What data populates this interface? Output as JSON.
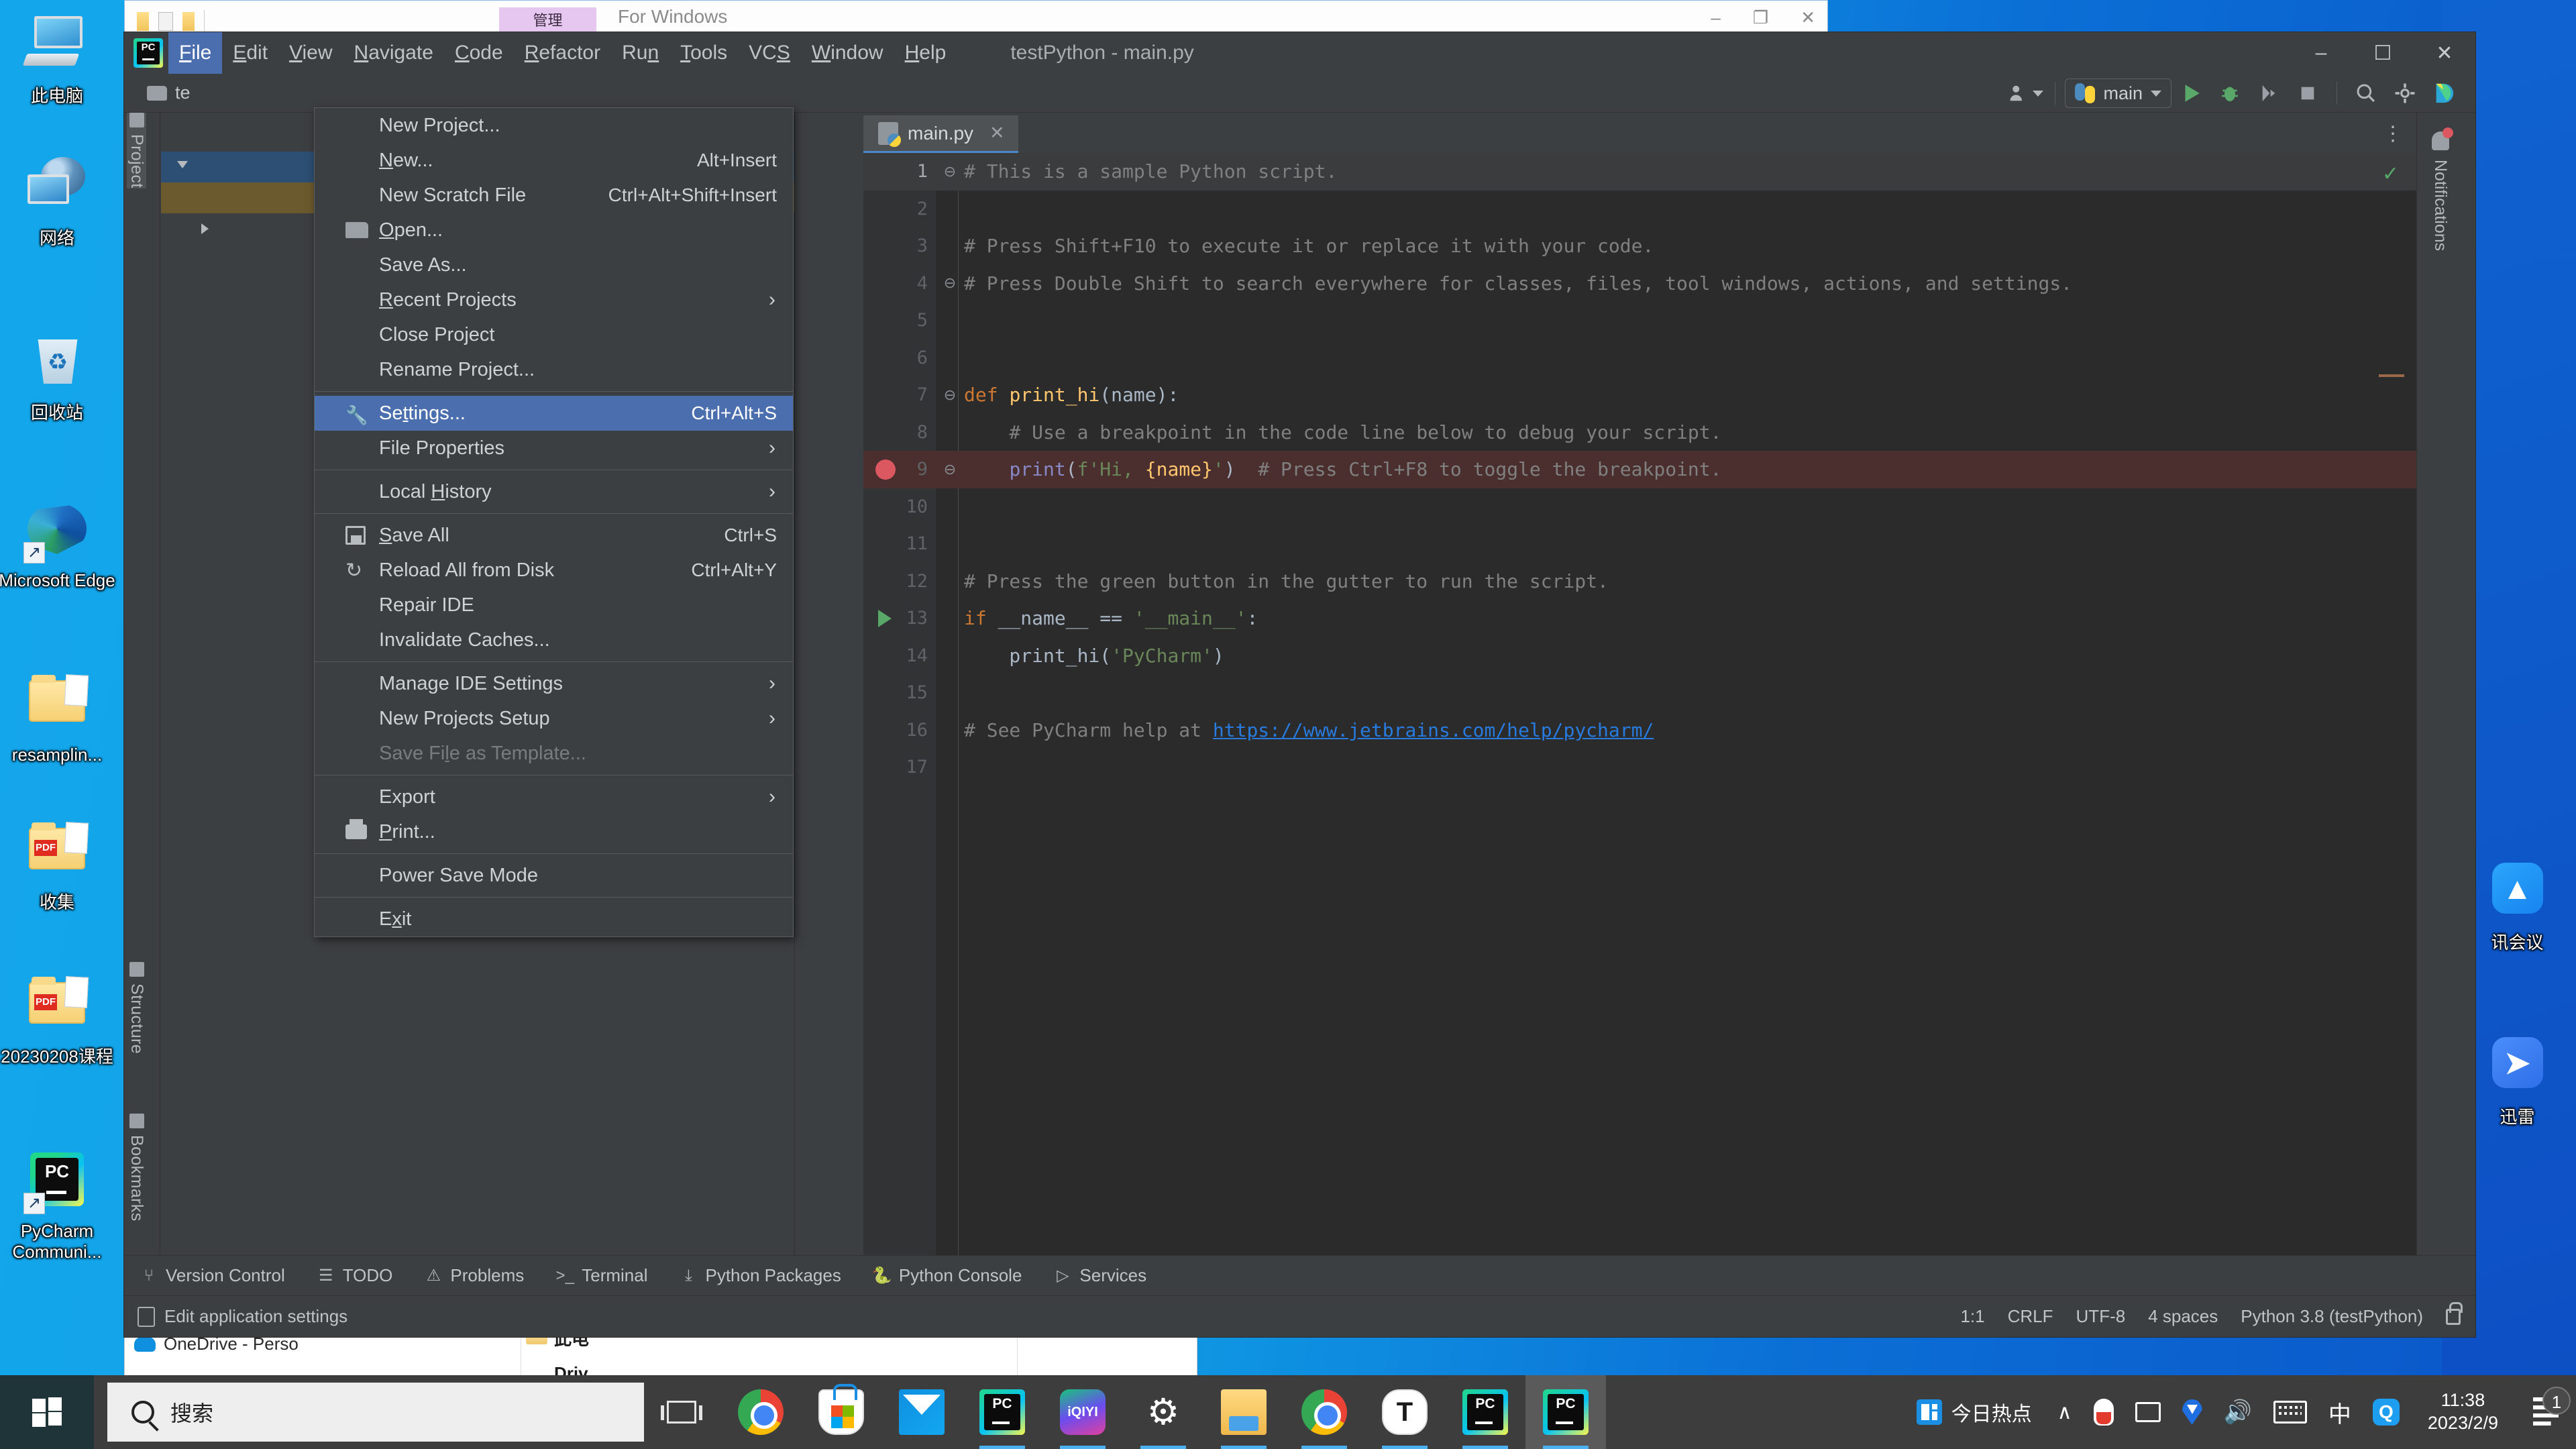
{
  "desktop": {
    "icons": [
      {
        "label": "此电脑",
        "icon": "this-pc-icon"
      },
      {
        "label": "网络",
        "icon": "network-icon"
      },
      {
        "label": "回收站",
        "icon": "recycle-bin-icon"
      },
      {
        "label": "Microsoft Edge",
        "icon": "edge-icon"
      },
      {
        "label": "resamplin...",
        "icon": "folder-icon"
      },
      {
        "label": "收集",
        "icon": "folder-pdf-icon"
      },
      {
        "label": "20230208课程",
        "icon": "folder-pdf-icon"
      },
      {
        "label": "PyCharm Communi...",
        "icon": "pycharm-icon"
      }
    ],
    "right_icons": [
      {
        "label": "讯会议",
        "icon": "tencent-meeting-icon"
      },
      {
        "label": "迅雷",
        "icon": "thunder-icon"
      }
    ]
  },
  "bg_window_top": {
    "title": "For Windows",
    "tab_label": "管理",
    "controls": [
      "–",
      "❐",
      "✕"
    ]
  },
  "bg_explorer": {
    "onedrive": "OneDrive - Perso",
    "col1": "此电",
    "col2": "Driv"
  },
  "pycharm": {
    "titlebar": {
      "logo": "pycharm-logo-icon",
      "document_title": "testPython - main.py",
      "window_controls": [
        "–",
        "☐",
        "✕"
      ],
      "menus": [
        {
          "label": "File",
          "mnemonic": "F",
          "active": true
        },
        {
          "label": "Edit",
          "mnemonic": "E",
          "active": false
        },
        {
          "label": "View",
          "mnemonic": "V",
          "active": false
        },
        {
          "label": "Navigate",
          "mnemonic": "N",
          "active": false
        },
        {
          "label": "Code",
          "mnemonic": "C",
          "active": false
        },
        {
          "label": "Refactor",
          "mnemonic": "R",
          "active": false
        },
        {
          "label": "Run",
          "mnemonic": "n",
          "active": false
        },
        {
          "label": "Tools",
          "mnemonic": "T",
          "active": false
        },
        {
          "label": "VCS",
          "mnemonic": "S",
          "active": false
        },
        {
          "label": "Window",
          "mnemonic": "W",
          "active": false
        },
        {
          "label": "Help",
          "mnemonic": "H",
          "active": false
        }
      ]
    },
    "navbar": {
      "project_name": "te",
      "run_config": "main",
      "icons": [
        "user-dropdown-icon",
        "python-icon",
        "run-icon",
        "debug-icon",
        "run-coverage-icon",
        "stop-icon",
        "search-everywhere-icon",
        "settings-gear-icon",
        "jetbrains-icon"
      ]
    },
    "left_tabs": [
      {
        "label": "Project",
        "selected": true
      },
      {
        "label": "Structure",
        "selected": false
      },
      {
        "label": "Bookmarks",
        "selected": false
      }
    ],
    "right_tabs": [
      {
        "label": "Notifications",
        "badge": true
      }
    ],
    "editor": {
      "tab": {
        "label": "main.py",
        "close": "✕",
        "icon": "python-file-icon"
      },
      "more_icon": "⋮",
      "inspection_ok": "✓"
    },
    "bottom_tools": [
      {
        "label": "Version Control",
        "icon": "branch-icon"
      },
      {
        "label": "TODO",
        "icon": "list-icon"
      },
      {
        "label": "Problems",
        "icon": "warning-icon"
      },
      {
        "label": "Terminal",
        "icon": "terminal-icon"
      },
      {
        "label": "Python Packages",
        "icon": "packages-icon"
      },
      {
        "label": "Python Console",
        "icon": "python-icon"
      },
      {
        "label": "Services",
        "icon": "services-icon"
      }
    ],
    "statusbar": {
      "left_text": "Edit application settings",
      "left_icon": "ide-settings-icon",
      "caret": "1:1",
      "line_sep": "CRLF",
      "encoding": "UTF-8",
      "indent": "4 spaces",
      "interpreter": "Python 3.8 (testPython)",
      "lock_icon": "unlocked-icon"
    }
  },
  "file_menu": {
    "items": [
      {
        "label": "New Project...",
        "accel": "",
        "icon": "",
        "submenu": false,
        "selected": false,
        "disabled": false
      },
      {
        "label": "New...",
        "mnemonic": "N",
        "accel": "Alt+Insert",
        "icon": "",
        "submenu": false,
        "selected": false,
        "disabled": false
      },
      {
        "label": "New Scratch File",
        "accel": "Ctrl+Alt+Shift+Insert",
        "icon": "",
        "submenu": false,
        "selected": false,
        "disabled": false
      },
      {
        "label": "Open...",
        "mnemonic": "O",
        "accel": "",
        "icon": "folder-icon",
        "submenu": false,
        "selected": false,
        "disabled": false
      },
      {
        "label": "Save As...",
        "accel": "",
        "icon": "",
        "submenu": false,
        "selected": false,
        "disabled": false
      },
      {
        "label": "Recent Projects",
        "mnemonic": "R",
        "accel": "",
        "icon": "",
        "submenu": true,
        "selected": false,
        "disabled": false
      },
      {
        "label": "Close Project",
        "accel": "",
        "icon": "",
        "submenu": false,
        "selected": false,
        "disabled": false
      },
      {
        "label": "Rename Project...",
        "accel": "",
        "icon": "",
        "submenu": false,
        "selected": false,
        "disabled": false
      },
      {
        "separator": true
      },
      {
        "label": "Settings...",
        "mnemonic": "t",
        "accel": "Ctrl+Alt+S",
        "icon": "wrench-icon",
        "submenu": false,
        "selected": true,
        "disabled": false
      },
      {
        "label": "File Properties",
        "accel": "",
        "icon": "",
        "submenu": true,
        "selected": false,
        "disabled": false
      },
      {
        "separator": true
      },
      {
        "label": "Local History",
        "mnemonic": "H",
        "accel": "",
        "icon": "",
        "submenu": true,
        "selected": false,
        "disabled": false
      },
      {
        "separator": true
      },
      {
        "label": "Save All",
        "mnemonic": "S",
        "accel": "Ctrl+S",
        "icon": "save-icon",
        "submenu": false,
        "selected": false,
        "disabled": false
      },
      {
        "label": "Reload All from Disk",
        "accel": "Ctrl+Alt+Y",
        "icon": "reload-icon",
        "submenu": false,
        "selected": false,
        "disabled": false
      },
      {
        "label": "Repair IDE",
        "accel": "",
        "icon": "",
        "submenu": false,
        "selected": false,
        "disabled": false
      },
      {
        "label": "Invalidate Caches...",
        "accel": "",
        "icon": "",
        "submenu": false,
        "selected": false,
        "disabled": false
      },
      {
        "separator": true
      },
      {
        "label": "Manage IDE Settings",
        "accel": "",
        "icon": "",
        "submenu": true,
        "selected": false,
        "disabled": false
      },
      {
        "label": "New Projects Setup",
        "accel": "",
        "icon": "",
        "submenu": true,
        "selected": false,
        "disabled": false
      },
      {
        "label": "Save File as Template...",
        "mnemonic": "l",
        "accel": "",
        "icon": "",
        "submenu": false,
        "selected": false,
        "disabled": true
      },
      {
        "separator": true
      },
      {
        "label": "Export",
        "accel": "",
        "icon": "",
        "submenu": true,
        "selected": false,
        "disabled": false
      },
      {
        "label": "Print...",
        "mnemonic": "P",
        "accel": "",
        "icon": "print-icon",
        "submenu": false,
        "selected": false,
        "disabled": false
      },
      {
        "separator": true
      },
      {
        "label": "Power Save Mode",
        "accel": "",
        "icon": "",
        "submenu": false,
        "selected": false,
        "disabled": false
      },
      {
        "separator": true
      },
      {
        "label": "Exit",
        "mnemonic": "x",
        "accel": "",
        "icon": "",
        "submenu": false,
        "selected": false,
        "disabled": false
      }
    ]
  },
  "code": {
    "lines": [
      {
        "n": 1,
        "fold": "⊖",
        "segments": [
          {
            "t": "# This is a sample Python script.",
            "c": "cmt"
          }
        ],
        "indent": 0,
        "highlight": "first"
      },
      {
        "n": 2,
        "fold": "",
        "segments": [],
        "indent": 0
      },
      {
        "n": 3,
        "fold": "",
        "segments": [
          {
            "t": "# Press Shift+F10 to execute it or replace it with your code.",
            "c": "cmt"
          }
        ],
        "indent": 1
      },
      {
        "n": 4,
        "fold": "⊖",
        "segments": [
          {
            "t": "# Press Double Shift to search everywhere for classes, files, tool windows, actions, and settings.",
            "c": "cmt"
          }
        ],
        "indent": 0
      },
      {
        "n": 5,
        "fold": "",
        "segments": [],
        "indent": 0
      },
      {
        "n": 6,
        "fold": "",
        "segments": [],
        "indent": 0
      },
      {
        "n": 7,
        "fold": "⊖",
        "segments": [
          {
            "t": "def ",
            "c": "kw"
          },
          {
            "t": "print_hi",
            "c": "fn"
          },
          {
            "t": "(name):",
            "c": "pun"
          }
        ],
        "indent": 0
      },
      {
        "n": 8,
        "fold": "",
        "segments": [
          {
            "t": "    # Use a breakpoint in the code line below to debug your script.",
            "c": "cmt"
          }
        ],
        "indent": 1
      },
      {
        "n": 9,
        "fold": "⊖",
        "segments": [
          {
            "t": "    ",
            "c": "pun"
          },
          {
            "t": "print",
            "c": "bld"
          },
          {
            "t": "(",
            "c": "pun"
          },
          {
            "t": "f'Hi, ",
            "c": "str"
          },
          {
            "t": "{name}",
            "c": "fn"
          },
          {
            "t": "'",
            "c": "str"
          },
          {
            "t": ")  ",
            "c": "pun"
          },
          {
            "t": "# Press Ctrl+F8 to toggle the breakpoint.",
            "c": "cmt"
          }
        ],
        "indent": 1,
        "highlight": "bp",
        "breakpoint": true
      },
      {
        "n": 10,
        "fold": "",
        "segments": [],
        "indent": 0
      },
      {
        "n": 11,
        "fold": "",
        "segments": [],
        "indent": 0
      },
      {
        "n": 12,
        "fold": "",
        "segments": [
          {
            "t": "# Press the green button in the gutter to run the script.",
            "c": "cmt"
          }
        ],
        "indent": 1
      },
      {
        "n": 13,
        "fold": "",
        "segments": [
          {
            "t": "if ",
            "c": "kw"
          },
          {
            "t": "__name__ == ",
            "c": "pun"
          },
          {
            "t": "'__main__'",
            "c": "str"
          },
          {
            "t": ":",
            "c": "pun"
          }
        ],
        "indent": 1,
        "runmark": true
      },
      {
        "n": 14,
        "fold": "",
        "segments": [
          {
            "t": "    print_hi(",
            "c": "pun"
          },
          {
            "t": "'PyCharm'",
            "c": "str"
          },
          {
            "t": ")",
            "c": "pun"
          }
        ],
        "indent": 1
      },
      {
        "n": 15,
        "fold": "",
        "segments": [],
        "indent": 0
      },
      {
        "n": 16,
        "fold": "",
        "segments": [
          {
            "t": "# See PyCharm help at ",
            "c": "cmt"
          },
          {
            "t": "https://www.jetbrains.com/help/pycharm/",
            "c": "lnk"
          }
        ],
        "indent": 1
      },
      {
        "n": 17,
        "fold": "",
        "segments": [],
        "indent": 0
      }
    ]
  },
  "taskbar": {
    "start": "start-button",
    "search_placeholder": "搜索",
    "task_view": "task-view-icon",
    "apps": [
      {
        "name": "chrome-icon",
        "active": false,
        "running": false
      },
      {
        "name": "microsoft-store-icon",
        "active": false,
        "running": false
      },
      {
        "name": "mail-icon",
        "active": false,
        "running": false
      },
      {
        "name": "pycharm-icon",
        "active": false,
        "running": true
      },
      {
        "name": "iqiyi-icon",
        "active": false,
        "running": true
      },
      {
        "name": "settings-gear-icon",
        "active": false,
        "running": true
      },
      {
        "name": "file-explorer-icon",
        "active": false,
        "running": true
      },
      {
        "name": "chrome-icon",
        "active": false,
        "running": true
      },
      {
        "name": "typora-icon",
        "active": false,
        "running": true
      },
      {
        "name": "pycharm-run-icon",
        "active": false,
        "running": true
      },
      {
        "name": "pycharm-icon",
        "active": true,
        "running": true
      }
    ],
    "tray": {
      "news_label": "今日热点",
      "chevron": "∧",
      "icons": [
        "qq-icon",
        "monitor-icon",
        "location-icon",
        "volume-icon",
        "keyboard-icon",
        "ime-chinese-icon",
        "qq-browser-icon"
      ],
      "ime_text": "中",
      "time": "11:38",
      "date": "2023/2/9",
      "action_center": "action-center-icon",
      "notification_count": "1"
    }
  }
}
